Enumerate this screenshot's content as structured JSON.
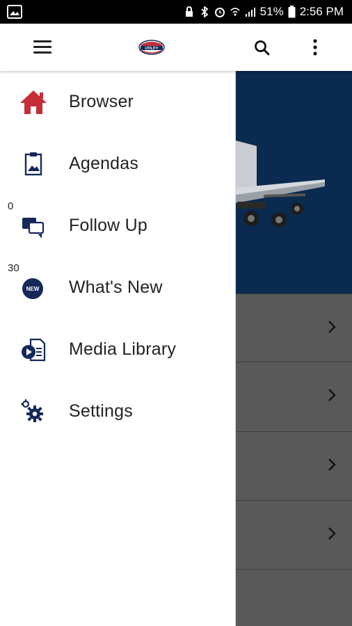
{
  "status_bar": {
    "battery": "51%",
    "time": "2:56 PM"
  },
  "app_bar": {
    "logo_text": "UTILITY"
  },
  "drawer": {
    "items": [
      {
        "label": "Browser",
        "icon": "home-icon",
        "badge": ""
      },
      {
        "label": "Agendas",
        "icon": "clipboard-icon",
        "badge": ""
      },
      {
        "label": "Follow Up",
        "icon": "chat-bubbles-icon",
        "badge": "0"
      },
      {
        "label": "What's New",
        "icon": "new-badge-icon",
        "badge": "30"
      },
      {
        "label": "Media Library",
        "icon": "media-library-icon",
        "badge": ""
      },
      {
        "label": "Settings",
        "icon": "gears-icon",
        "badge": ""
      }
    ]
  },
  "colors": {
    "accent_red": "#c62f38",
    "navy": "#14285a",
    "hero_bg": "#0a2a4f",
    "scrim": "#5a5a5a"
  }
}
